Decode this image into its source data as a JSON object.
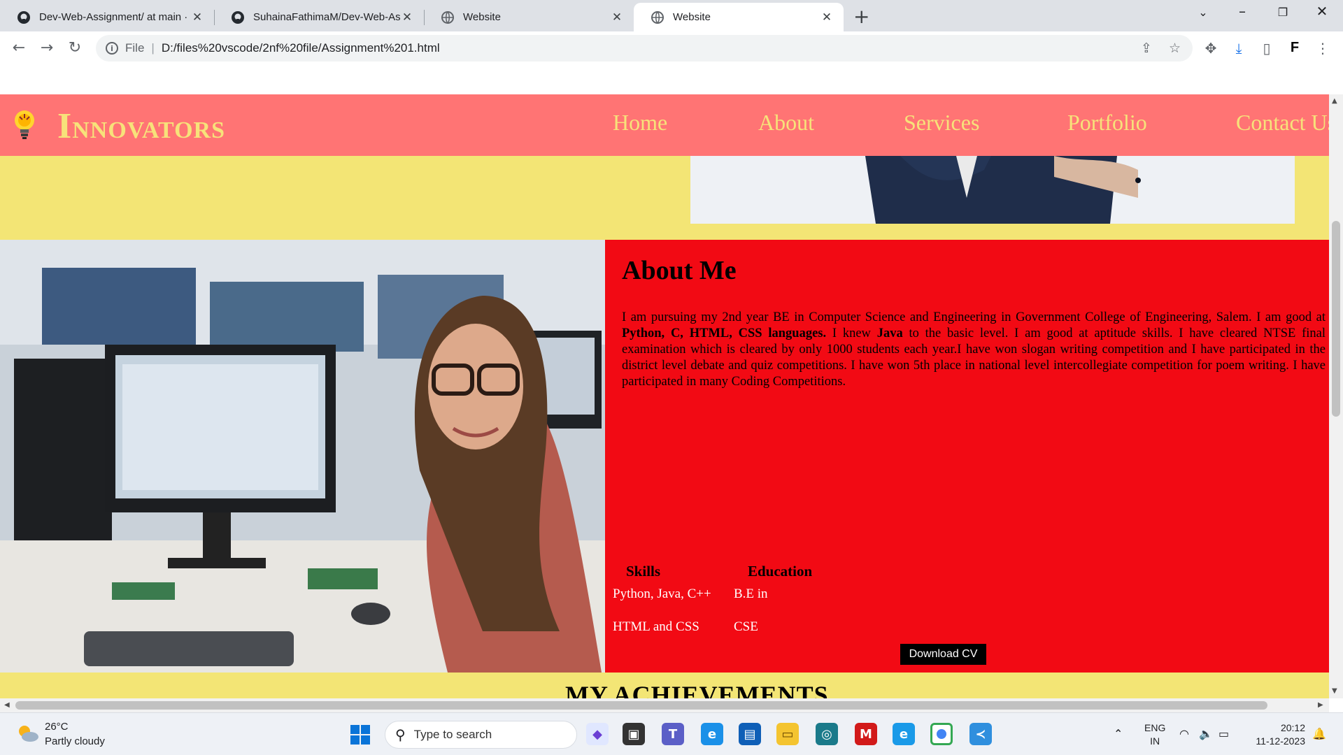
{
  "browser": {
    "tabs": [
      {
        "label": "Dev-Web-Assignment/ at main ·",
        "icon": "github-icon",
        "active": false
      },
      {
        "label": "SuhainaFathimaM/Dev-Web-Ass",
        "icon": "github-icon",
        "active": false
      },
      {
        "label": "Website",
        "icon": "globe-icon",
        "active": false
      },
      {
        "label": "Website",
        "icon": "globe-icon",
        "active": true
      }
    ],
    "address": {
      "scheme": "File",
      "url": "D:/files%20vscode/2nf%20file/Assignment%201.html"
    },
    "profile_letter": "F"
  },
  "site": {
    "brand": {
      "first_letter": "I",
      "rest": "NNOVATORS"
    },
    "nav": [
      "Home",
      "About",
      "Services",
      "Portfolio",
      "Contact Us"
    ],
    "about": {
      "title": "About Me",
      "text_parts": [
        "I am pursuing my 2nd year BE in Computer Science and Engineering in Government College of Engineering, Salem. I am good at ",
        "Python, C, HTML, CSS languages.",
        " I knew ",
        "Java",
        " to the basic level. I am good at aptitude skills. I have cleared NTSE final examination which is cleared by only 1000 students each year.I have won slogan writing competition and I have participated in the district level debate and quiz competitions. I have won 5th place in national level intercollegiate competition for poem writing. I have participated in many Coding Competitions."
      ],
      "skills_heading": "Skills",
      "skills": [
        "Python, Java, C++",
        "HTML and CSS"
      ],
      "education_heading": "Education",
      "education": [
        "B.E in",
        "CSE"
      ],
      "download_label": "Download CV"
    },
    "achievements_heading": "MY ACHIEVEMENTS"
  },
  "taskbar": {
    "weather": {
      "temp": "26°C",
      "desc": "Partly cloudy"
    },
    "search_placeholder": "Type to search",
    "lang": {
      "line1": "ENG",
      "line2": "IN"
    },
    "clock": {
      "time": "20:12",
      "date": "11-12-2023"
    }
  },
  "colors": {
    "header_bg": "#ff7474",
    "page_bg": "#f3e575",
    "about_bg": "#f20a14",
    "brand_text": "#f7e27a"
  }
}
